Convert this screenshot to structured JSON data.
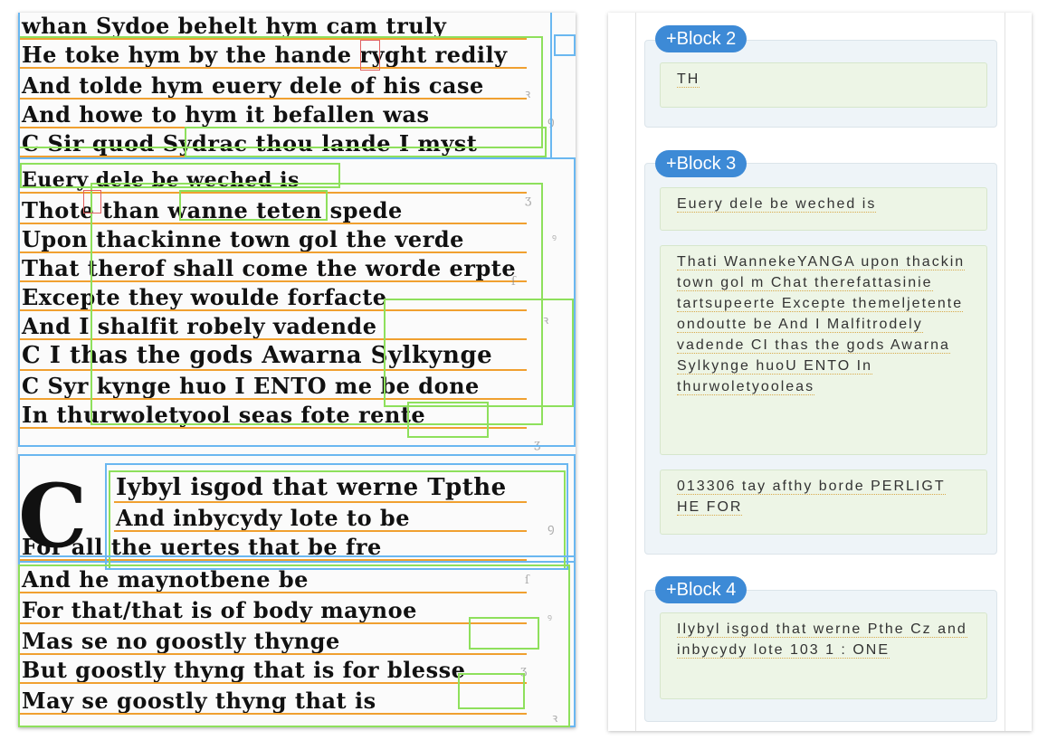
{
  "scan": {
    "lines": [
      "whan Sydoe behelt hym cam truly",
      "He toke hym by the hande ryght redily",
      "And tolde hym euery dele of his case",
      "And howe to hym it befallen was",
      "C Sir quod Sydrac thou lande I myst",
      "Euery dele be weched is",
      "Thote than wanne teten spede",
      "Upon thackinne town gol the verde",
      "That therof shall come the worde erpte",
      "Excepte they woulde forfacte",
      "And I shalfit robely vadende",
      "C I thas the gods Awarna Sylkynge",
      "C Syr kynge huo I ENTO me be done",
      "In thurwoletyool seas fote rente",
      "Iybyl isgod that werne Tpthe",
      "And inbycydy lote to be",
      "For all the uertes that be fre",
      "And he maynotbene be",
      "For that/that is of body maynoe",
      "Mas se no goostly thynge",
      "But goostly thyng that is for blesse",
      "May se goostly thyng that is"
    ],
    "dropcap": "C",
    "specks": [
      "ꝛ",
      "ꝯ",
      "ʒ",
      "ꝰ",
      "ſ",
      "ꝛ",
      "ʒ",
      "ꝯ",
      "ſ",
      "ꝰ",
      "ʒ",
      "ꝛ"
    ]
  },
  "blocks": [
    {
      "tag": "+Block 2",
      "lines": [
        "TH"
      ]
    },
    {
      "tag": "+Block 3",
      "lines": [
        "Euery dele be weched is",
        "Thati WannekeYANGA upon thackin town gol m Chat therefattasinie tartsupeerte Excepte themeljetente ondoutte be And I Malfitrodely vadende CI thas the gods Awarna Sylkynge huoU ENTO In thurwoletyooleas",
        "013306 tay afthy borde PERLIGT HE FOR"
      ]
    },
    {
      "tag": "+Block 4",
      "lines": [
        "Ilybyl isgod that werne Pthe Cz and inbycydy lote 103 1 : ONE"
      ]
    }
  ]
}
